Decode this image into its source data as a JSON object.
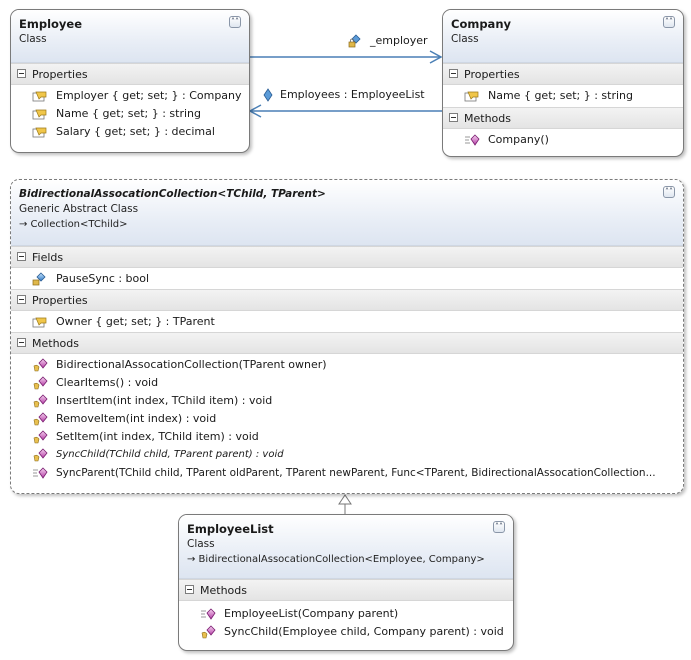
{
  "employee": {
    "name": "Employee",
    "kind": "Class",
    "sections": {
      "properties": {
        "title": "Properties",
        "items": [
          "Employer { get; set; } : Company",
          "Name { get; set; } : string",
          "Salary { get; set; } : decimal"
        ]
      }
    }
  },
  "company": {
    "name": "Company",
    "kind": "Class",
    "sections": {
      "properties": {
        "title": "Properties",
        "items": [
          "Name { get; set; } : string"
        ]
      },
      "methods": {
        "title": "Methods",
        "items": [
          "Company()"
        ]
      }
    }
  },
  "associations": {
    "employer_label": "_employer",
    "employees_label": "Employees : EmployeeList"
  },
  "collection": {
    "name": "BidirectionalAssocationCollection<TChild, TParent>",
    "kind": "Generic Abstract Class",
    "base": "→ Collection<TChild>",
    "sections": {
      "fields": {
        "title": "Fields",
        "items": [
          "PauseSync : bool"
        ]
      },
      "properties": {
        "title": "Properties",
        "items": [
          "Owner { get; set; } : TParent"
        ]
      },
      "methods": {
        "title": "Methods",
        "items": [
          "BidirectionalAssocationCollection(TParent owner)",
          "ClearItems() : void",
          "InsertItem(int index, TChild item) : void",
          "RemoveItem(int index) : void",
          "SetItem(int index, TChild item) : void",
          "SyncChild(TChild child, TParent parent) : void",
          "SyncParent(TChild child,  TParent oldParent,  TParent newParent,  Func<TParent,  BidirectionalAssocationCollection..."
        ]
      }
    }
  },
  "employee_list": {
    "name": "EmployeeList",
    "kind": "Class",
    "base": "→ BidirectionalAssocationCollection<Employee, Company>",
    "sections": {
      "methods": {
        "title": "Methods",
        "items": [
          "EmployeeList(Company parent)",
          "SyncChild(Employee child, Company parent) : void"
        ]
      }
    }
  },
  "ui": {
    "collapse_glyph": "˄˄"
  }
}
